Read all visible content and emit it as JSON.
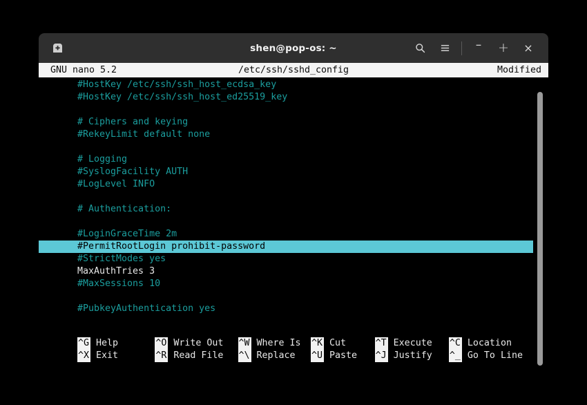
{
  "window": {
    "titlebar": {
      "new_tab_icon": "terminal-plus-icon",
      "title": "shen@pop-os: ~",
      "search_icon": "search-icon",
      "menu_icon": "hamburger-menu-icon",
      "minimize_label": "–",
      "maximize_label": "+",
      "close_label": "×"
    }
  },
  "nano": {
    "version": "GNU nano 5.2",
    "filename": "/etc/ssh/sshd_config",
    "status": "Modified"
  },
  "colors": {
    "comment": "#1b9e9e",
    "active_line": "#e8e8e8",
    "highlight_bg": "#5cc8d6",
    "titlebar_bg": "#2f2f2f",
    "header_bg": "#f4f4f4",
    "terminal_bg": "#000000",
    "scrollbar": "#9a9a9a"
  },
  "editor": {
    "lines": [
      {
        "text": "#HostKey /etc/ssh/ssh_host_ecdsa_key",
        "style": "comment"
      },
      {
        "text": "#HostKey /etc/ssh/ssh_host_ed25519_key",
        "style": "comment"
      },
      {
        "text": "",
        "style": "blank"
      },
      {
        "text": "# Ciphers and keying",
        "style": "comment"
      },
      {
        "text": "#RekeyLimit default none",
        "style": "comment"
      },
      {
        "text": "",
        "style": "blank"
      },
      {
        "text": "# Logging",
        "style": "comment"
      },
      {
        "text": "#SyslogFacility AUTH",
        "style": "comment"
      },
      {
        "text": "#LogLevel INFO",
        "style": "comment"
      },
      {
        "text": "",
        "style": "blank"
      },
      {
        "text": "# Authentication:",
        "style": "comment"
      },
      {
        "text": "",
        "style": "blank"
      },
      {
        "text": "#LoginGraceTime 2m",
        "style": "comment"
      },
      {
        "text": "#PermitRootLogin prohibit-password",
        "style": "highlight"
      },
      {
        "text": "#StrictModes yes",
        "style": "comment"
      },
      {
        "text": "MaxAuthTries 3",
        "style": "active"
      },
      {
        "text": "#MaxSessions 10",
        "style": "comment"
      },
      {
        "text": "",
        "style": "blank"
      },
      {
        "text": "#PubkeyAuthentication yes",
        "style": "comment"
      }
    ]
  },
  "shortcuts": {
    "columns": [
      {
        "top": {
          "key": "^G",
          "label": "Help"
        },
        "bottom": {
          "key": "^X",
          "label": "Exit"
        }
      },
      {
        "top": {
          "key": "^O",
          "label": "Write Out"
        },
        "bottom": {
          "key": "^R",
          "label": "Read File"
        }
      },
      {
        "top": {
          "key": "^W",
          "label": "Where Is"
        },
        "bottom": {
          "key": "^\\",
          "label": "Replace"
        }
      },
      {
        "top": {
          "key": "^K",
          "label": "Cut"
        },
        "bottom": {
          "key": "^U",
          "label": "Paste"
        }
      },
      {
        "top": {
          "key": "^T",
          "label": "Execute"
        },
        "bottom": {
          "key": "^J",
          "label": "Justify"
        }
      },
      {
        "top": {
          "key": "^C",
          "label": "Location"
        },
        "bottom": {
          "key": "^_",
          "label": "Go To Line"
        }
      }
    ]
  }
}
